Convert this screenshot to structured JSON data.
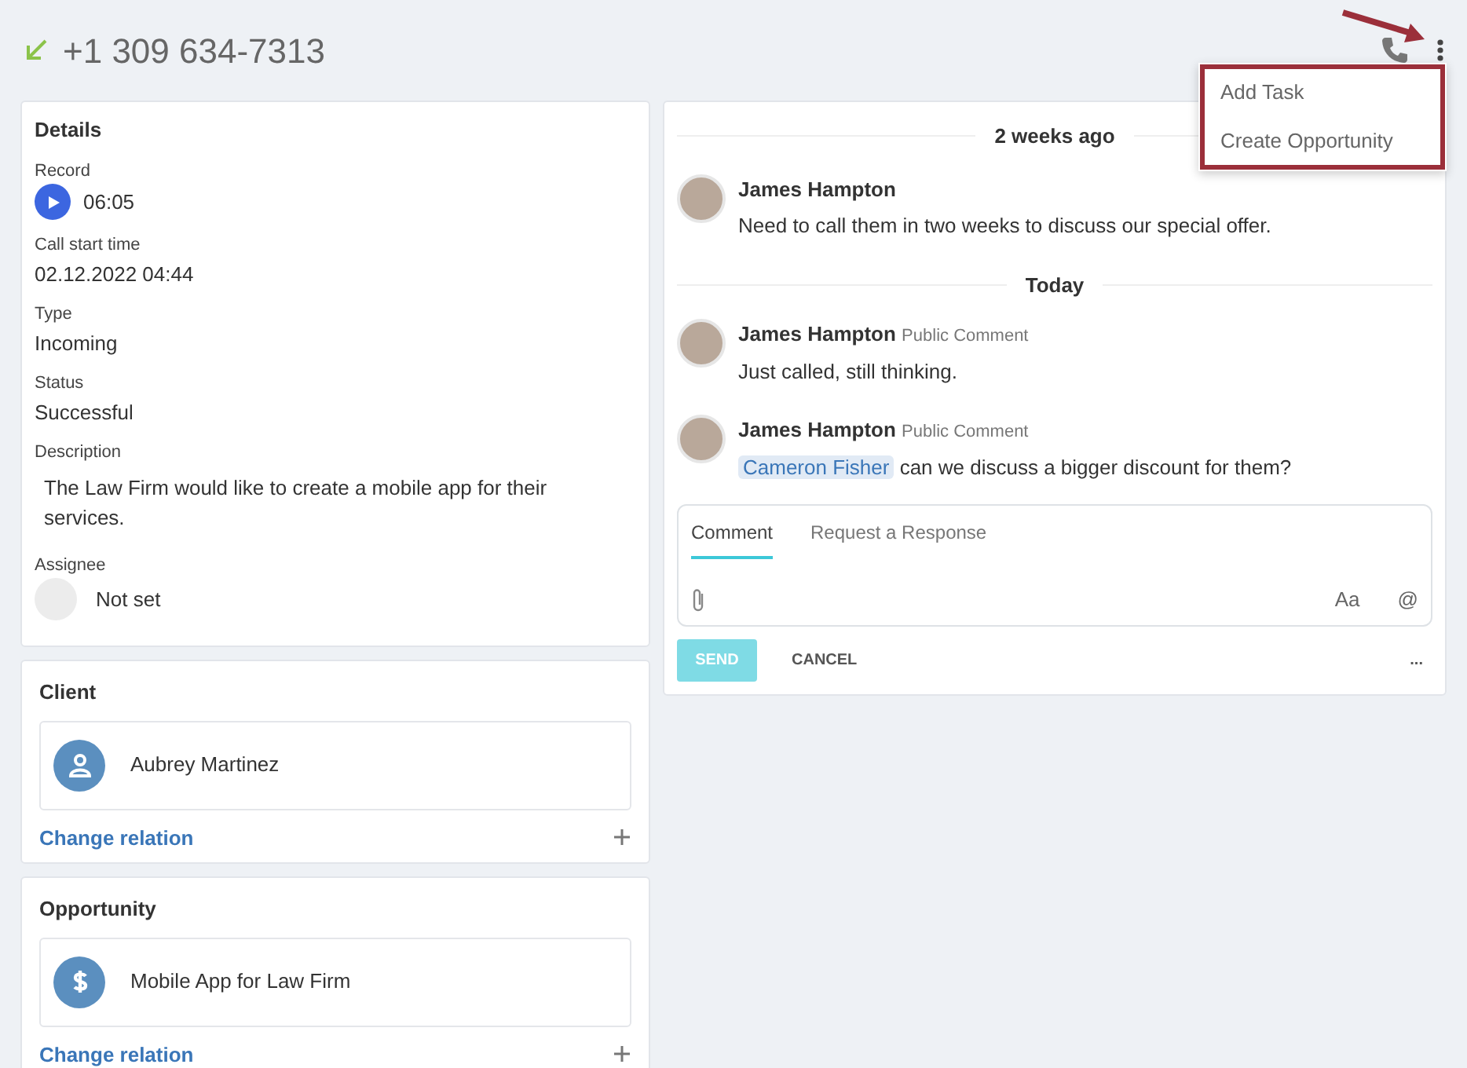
{
  "header": {
    "phone": "+1 309 634-7313"
  },
  "menu": {
    "highlighted": true,
    "items": [
      {
        "label": "Add Task"
      },
      {
        "label": "Create Opportunity"
      }
    ]
  },
  "details": {
    "title": "Details",
    "fields": [
      {
        "kind": "record",
        "label": "Record",
        "value": "06:05"
      },
      {
        "kind": "text",
        "label": "Call start time",
        "value": "02.12.2022 04:44"
      },
      {
        "kind": "text",
        "label": "Type",
        "value": "Incoming"
      },
      {
        "kind": "text",
        "label": "Status",
        "value": "Successful"
      },
      {
        "kind": "description",
        "label": "Description",
        "value": "The Law Firm would like to create a mobile app for their services."
      },
      {
        "kind": "assignee",
        "label": "Assignee",
        "value": "Not set"
      }
    ]
  },
  "relations": [
    {
      "title": "Client",
      "kind": "contact",
      "name": "Aubrey Martinez",
      "link": "Change relation"
    },
    {
      "title": "Opportunity",
      "kind": "deal",
      "name": "Mobile App for Law Firm",
      "link": "Change relation"
    }
  ],
  "feed": [
    {
      "date": "2 weeks ago",
      "comments": [
        {
          "author": "James Hampton",
          "text": "Need to call them in two weeks to discuss our special offer."
        }
      ]
    },
    {
      "date": "Today",
      "comments": [
        {
          "author": "James Hampton",
          "tag": "Public Comment",
          "text": "Just called, still thinking."
        },
        {
          "author": "James Hampton",
          "tag": "Public Comment",
          "mention": "Cameron Fisher",
          "text": "can we discuss a bigger discount for them?"
        }
      ]
    }
  ],
  "composer": {
    "tabs": [
      {
        "label": "Comment",
        "selected": true
      },
      {
        "label": "Request a Response",
        "selected": false
      }
    ],
    "tools": [
      "Aa",
      "@"
    ],
    "send": {
      "label": "SEND",
      "disabled": true
    },
    "cancel": "CANCEL",
    "more": "..."
  }
}
